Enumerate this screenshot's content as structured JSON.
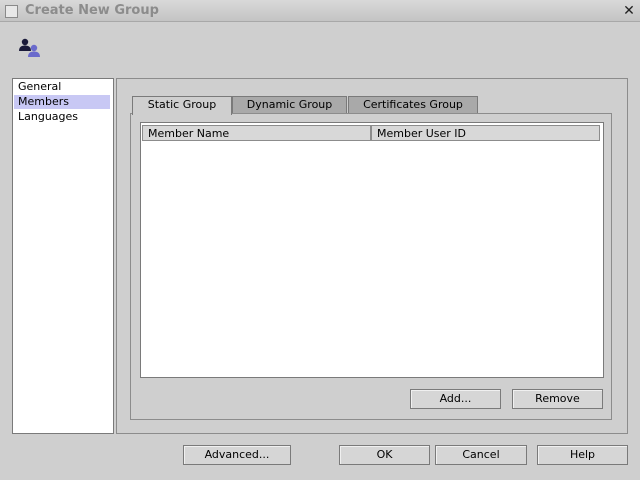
{
  "window": {
    "title": "Create New Group",
    "close_glyph": "✕"
  },
  "header": {
    "icon": "group-users-icon"
  },
  "nav": {
    "items": [
      {
        "label": "General"
      },
      {
        "label": "Members",
        "selected": true
      },
      {
        "label": "Languages"
      }
    ]
  },
  "tabs": [
    {
      "label": "Static Group",
      "active": true
    },
    {
      "label": "Dynamic Group"
    },
    {
      "label": "Certificates Group"
    }
  ],
  "members_table": {
    "columns": [
      "Member Name",
      "Member User ID"
    ],
    "rows": []
  },
  "panel_buttons": {
    "add": "Add...",
    "remove": "Remove"
  },
  "footer_buttons": {
    "advanced": "Advanced...",
    "ok": "OK",
    "cancel": "Cancel",
    "help": "Help"
  },
  "colors": {
    "selection": "#c8c8f4",
    "dialog_background": "#cfcfcf",
    "icon_dark": "#1a1a3a",
    "icon_accent": "#6a6acc"
  }
}
